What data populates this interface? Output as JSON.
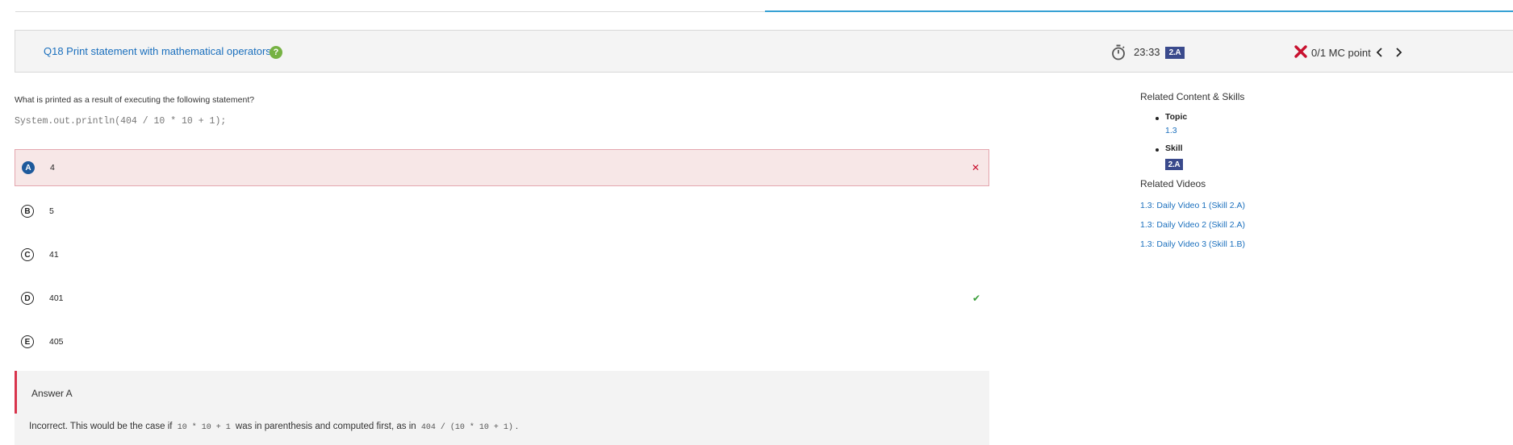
{
  "header": {
    "question_title": "Q18 Print statement with mathematical operators",
    "help_icon": "?",
    "timer": "23:33",
    "skill_badge": "2.A",
    "score": "0/1 MC point"
  },
  "question": {
    "prompt": "What is printed as a result of executing the following statement?",
    "code": "System.out.println(404 / 10 * 10 + 1);"
  },
  "choices": [
    {
      "letter": "A",
      "text": "4",
      "state": "selected-wrong",
      "mark": "✕"
    },
    {
      "letter": "B",
      "text": "5",
      "state": "",
      "mark": ""
    },
    {
      "letter": "C",
      "text": "41",
      "state": "",
      "mark": ""
    },
    {
      "letter": "D",
      "text": "401",
      "state": "correct",
      "mark": "✔"
    },
    {
      "letter": "E",
      "text": "405",
      "state": "",
      "mark": ""
    }
  ],
  "explanation": {
    "title": "Answer A",
    "text_before": "Incorrect. This would be the case if",
    "code1": "10 * 10 + 1",
    "text_middle": "was in parenthesis and computed first, as in",
    "code2": "404 / (10 * 10 + 1)",
    "text_after": "."
  },
  "sidebar": {
    "related_title": "Related Content & Skills",
    "topic_label": "Topic",
    "topic_value": "1.3",
    "skill_label": "Skill",
    "skill_value": "2.A",
    "videos_title": "Related Videos",
    "videos": [
      "1.3: Daily Video 1 (Skill 2.A)",
      "1.3: Daily Video 2 (Skill 2.A)",
      "1.3: Daily Video 3 (Skill 1.B)"
    ]
  },
  "colors": {
    "link": "#1a6fbd",
    "wrong": "#c8102e",
    "correct": "#3a9e3a",
    "badge": "#3a4a8c",
    "progress": "#36a1d4"
  }
}
